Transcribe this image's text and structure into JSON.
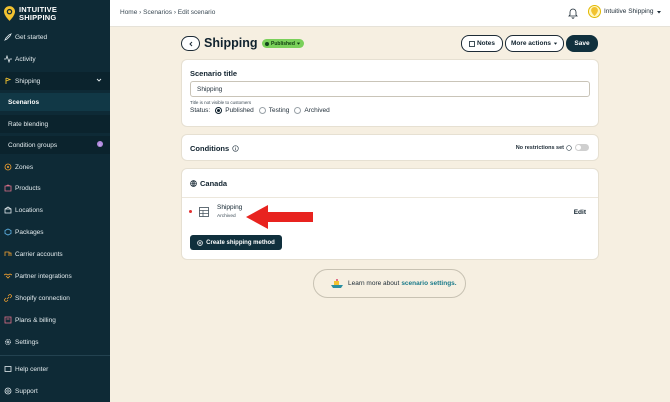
{
  "brand": {
    "line1": "INTUITIVE",
    "line2": "SHIPPING"
  },
  "sidebar": {
    "items": [
      {
        "label": "Get started",
        "icon": "rocket-icon"
      },
      {
        "label": "Activity",
        "icon": "activity-icon"
      },
      {
        "label": "Shipping",
        "icon": "shipping-icon"
      },
      {
        "label": "Scenarios"
      },
      {
        "label": "Rate blending"
      },
      {
        "label": "Condition groups",
        "badge": "i"
      },
      {
        "label": "Zones",
        "icon": "zones-icon"
      },
      {
        "label": "Products",
        "icon": "products-icon"
      },
      {
        "label": "Locations",
        "icon": "locations-icon"
      },
      {
        "label": "Packages",
        "icon": "packages-icon"
      },
      {
        "label": "Carrier accounts",
        "icon": "carrier-icon"
      },
      {
        "label": "Partner integrations",
        "icon": "handshake-icon"
      },
      {
        "label": "Shopify connection",
        "icon": "link-icon"
      },
      {
        "label": "Plans & billing",
        "icon": "billing-icon"
      },
      {
        "label": "Settings",
        "icon": "gear-icon"
      },
      {
        "label": "Help center",
        "icon": "help-icon"
      },
      {
        "label": "Support",
        "icon": "support-icon"
      }
    ]
  },
  "topbar": {
    "breadcrumb": "Home › Scenarios › Edit scenario",
    "account": "Intuitive Shipping"
  },
  "header": {
    "title": "Shipping",
    "status_badge": "Published",
    "notes_label": "Notes",
    "more_actions_label": "More actions",
    "save_label": "Save"
  },
  "scenario": {
    "section_title": "Scenario title",
    "title_value": "Shipping",
    "hint": "Title is not visible to customers",
    "status_label": "Status:",
    "statuses": [
      "Published",
      "Testing",
      "Archived"
    ],
    "selected_status": "Published"
  },
  "conditions": {
    "title": "Conditions",
    "restriction_text": "No restrictions set"
  },
  "region": {
    "title": "Canada",
    "method_name": "Shipping",
    "method_status": "Archived",
    "edit_label": "Edit",
    "create_label": "Create shipping method"
  },
  "learn_more": {
    "text": "Learn more about",
    "link": "scenario settings."
  },
  "colors": {
    "sidebar_bg": "#0e2a36",
    "page_bg": "#f6efe1",
    "accent_dark": "#10303d",
    "published_green": "#7ad05a",
    "arrow_red": "#e8231f",
    "link_teal": "#1a7a8a"
  }
}
